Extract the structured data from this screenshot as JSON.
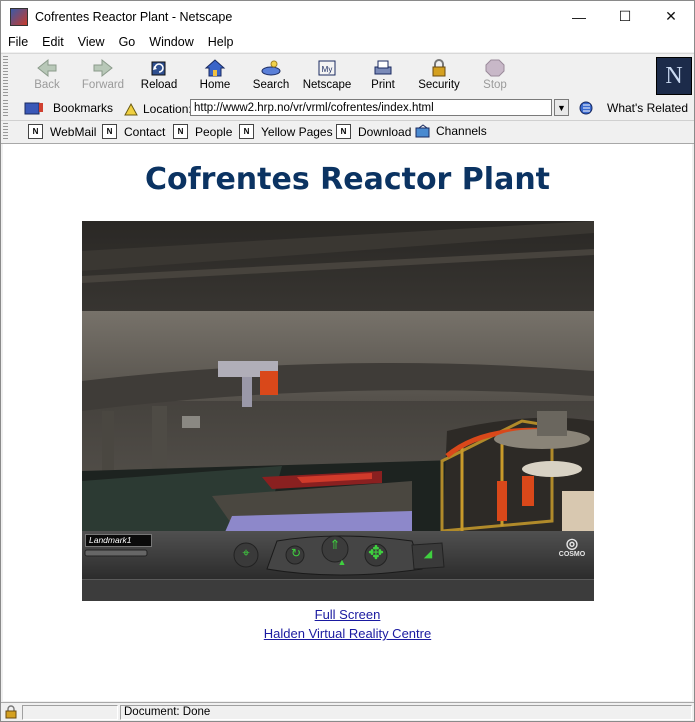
{
  "window": {
    "title": "Cofrentes Reactor Plant - Netscape",
    "minimize_glyph": "—",
    "maximize_glyph": "☐",
    "close_glyph": "✕"
  },
  "menu": [
    "File",
    "Edit",
    "View",
    "Go",
    "Window",
    "Help"
  ],
  "toolbar": {
    "back": "Back",
    "forward": "Forward",
    "reload": "Reload",
    "home": "Home",
    "search": "Search",
    "netscape": "Netscape",
    "print": "Print",
    "security": "Security",
    "stop": "Stop",
    "logo": "N"
  },
  "location": {
    "bookmarks": "Bookmarks",
    "label": "Location:",
    "url": "http://www2.hrp.no/vr/vrml/cofrentes/index.html",
    "whats_related": "What's Related"
  },
  "personal": [
    "WebMail",
    "Contact",
    "People",
    "Yellow Pages",
    "Download",
    "Channels"
  ],
  "page": {
    "title": "Cofrentes Reactor Plant",
    "viewer": {
      "landmark": "Landmark1",
      "brand": "COSMO"
    },
    "links": [
      "Full Screen",
      "Halden Virtual Reality Centre"
    ]
  },
  "status": {
    "text": "Document: Done"
  },
  "colors": {
    "title": "#0b3362",
    "link": "#1a1aa0",
    "accent_orange": "#d9481a"
  }
}
